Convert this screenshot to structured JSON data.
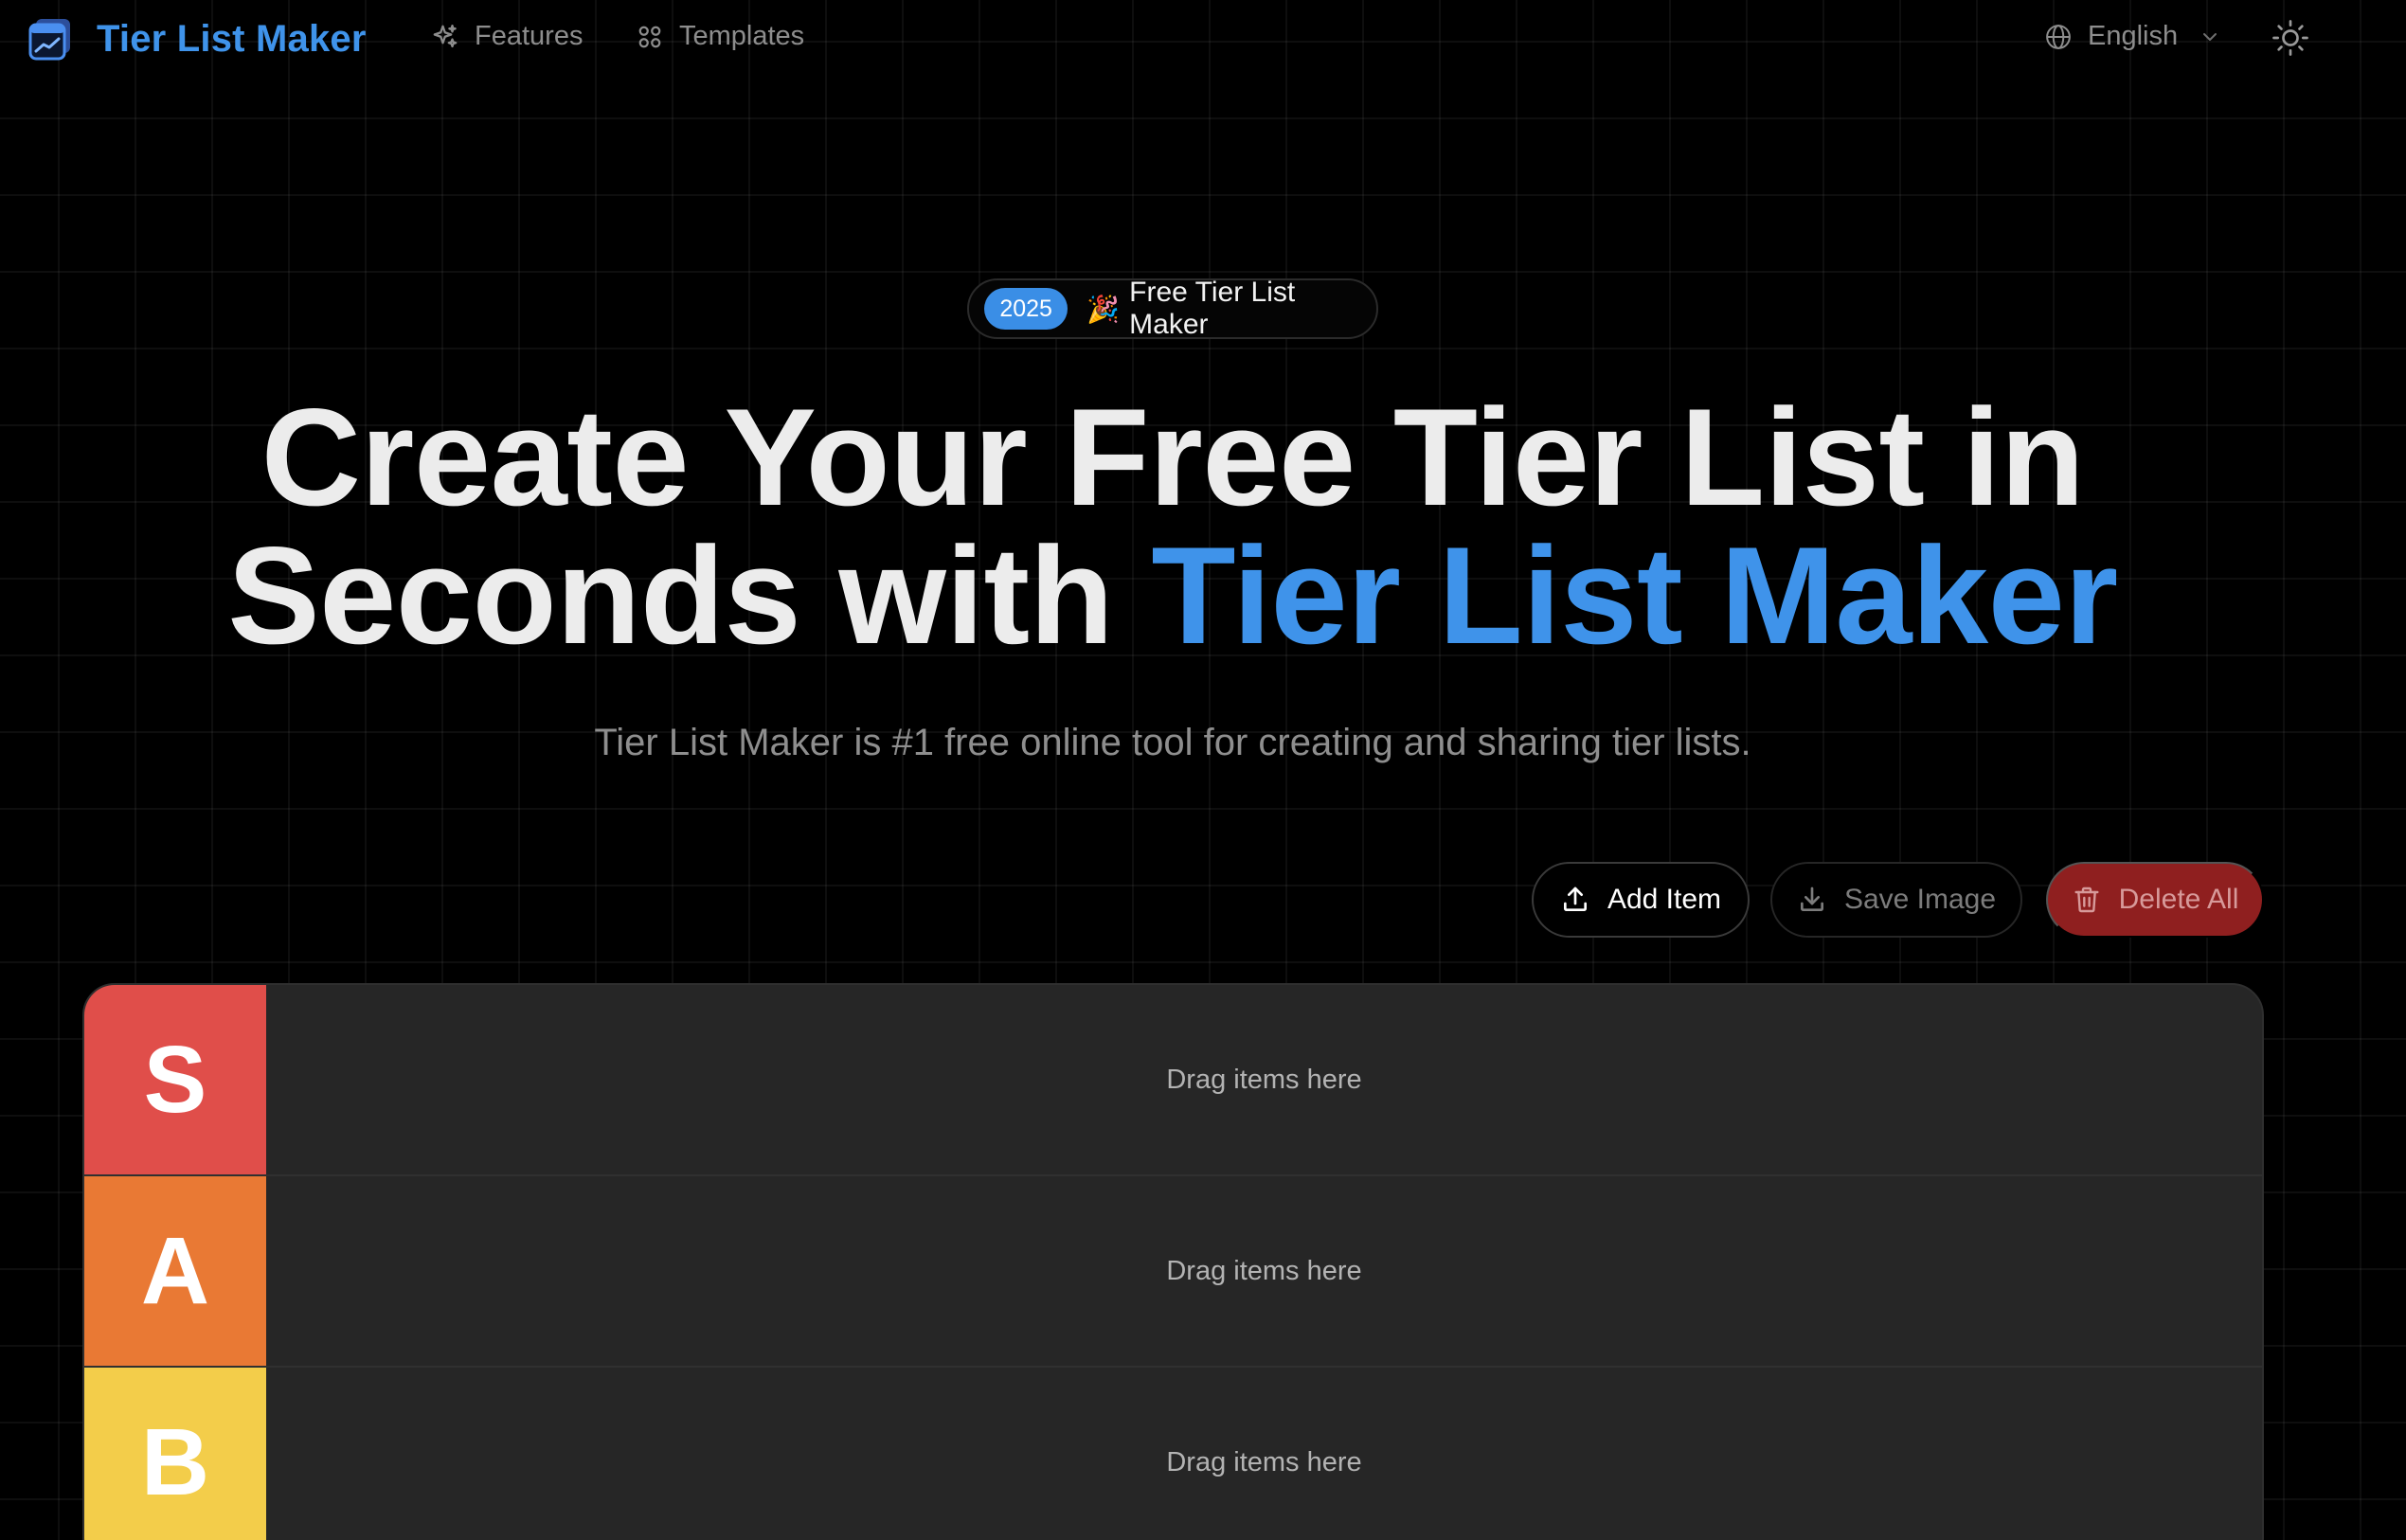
{
  "nav": {
    "brand": "Tier List Maker",
    "links": [
      {
        "label": "Features",
        "icon": "sparkles-icon"
      },
      {
        "label": "Templates",
        "icon": "grid-icon"
      }
    ],
    "language": "English",
    "theme_icon": "sun-icon"
  },
  "hero": {
    "badge_year": "2025",
    "badge_emoji": "🎉",
    "badge_text": "Free Tier List Maker",
    "title_line1": "Create Your Free Tier List in",
    "title_line2_prefix": "Seconds with ",
    "title_line2_accent": "Tier List Maker",
    "subtitle": "Tier List Maker is #1 free online tool for creating and sharing tier lists."
  },
  "actions": {
    "add_item": "Add Item",
    "save_image": "Save Image",
    "delete_all": "Delete All"
  },
  "tiers": [
    {
      "label": "S",
      "color": "#e04e4a",
      "placeholder": "Drag items here"
    },
    {
      "label": "A",
      "color": "#e97934",
      "placeholder": "Drag items here"
    },
    {
      "label": "B",
      "color": "#f3cd4a",
      "placeholder": "Drag items here"
    }
  ],
  "colors": {
    "accent": "#3f93ea",
    "background": "#000000",
    "board": "#262626",
    "danger": "#8f1f1f"
  }
}
